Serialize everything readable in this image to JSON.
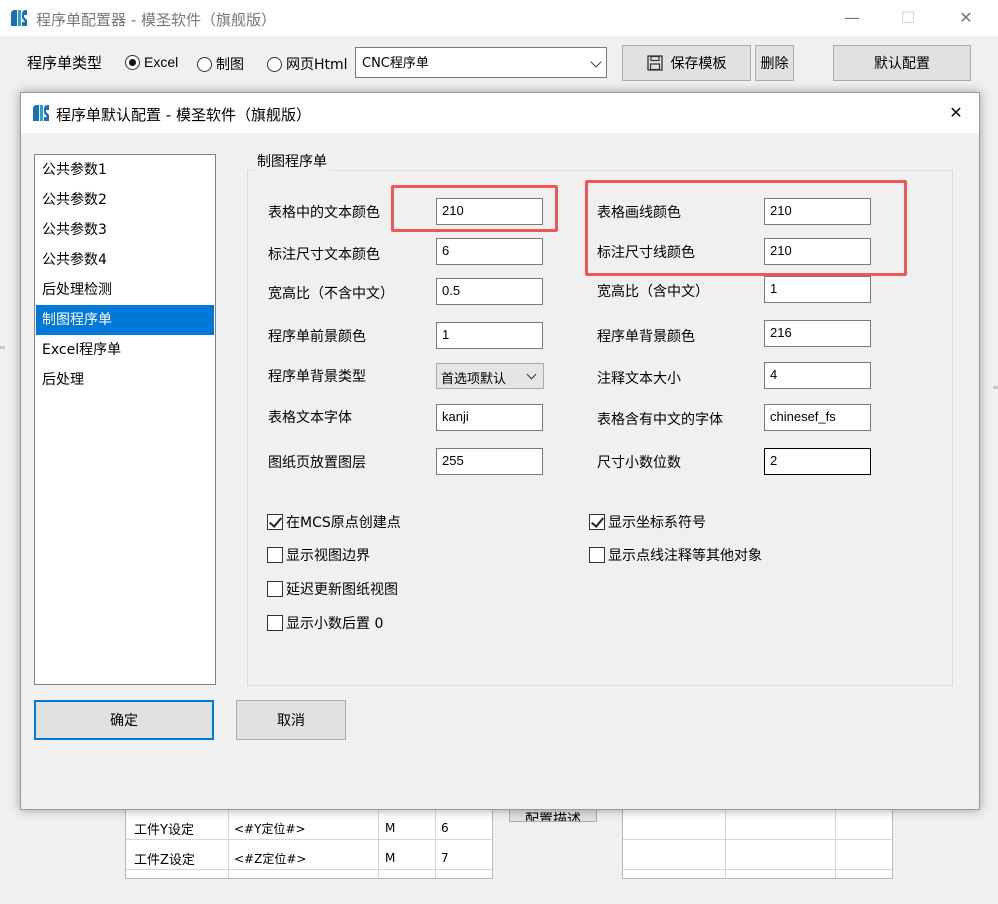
{
  "main_window": {
    "title": "程序单配置器 - 模圣软件（旗舰版）",
    "logo_text": "MS",
    "controls": {
      "minimize": "—",
      "maximize": "☐",
      "close": "✕"
    },
    "toolbar": {
      "type_label": "程序单类型",
      "radios": [
        {
          "label": "Excel",
          "selected": true
        },
        {
          "label": "制图",
          "selected": false
        },
        {
          "label": "网页Html",
          "selected": false
        }
      ],
      "template_select": "CNC程序单",
      "save_template_label": "保存模板",
      "delete_label": "删除",
      "default_config_label": "默认配置"
    },
    "background": {
      "table_rows": [
        {
          "name": "工件Y设定",
          "code": "<#Y定位#>",
          "type": "M",
          "num": "6"
        },
        {
          "name": "工件Z设定",
          "code": "<#Z定位#>",
          "type": "M",
          "num": "7"
        }
      ],
      "partial_button": "配置描述"
    }
  },
  "dialog": {
    "title": "程序单默认配置 - 模圣软件（旗舰版）",
    "close": "✕",
    "nav": [
      {
        "label": "公共参数1",
        "selected": false
      },
      {
        "label": "公共参数2",
        "selected": false
      },
      {
        "label": "公共参数3",
        "selected": false
      },
      {
        "label": "公共参数4",
        "selected": false
      },
      {
        "label": "后处理检测",
        "selected": false
      },
      {
        "label": "制图程序单",
        "selected": true
      },
      {
        "label": "Excel程序单",
        "selected": false
      },
      {
        "label": "后处理",
        "selected": false
      }
    ],
    "group_title": "制图程序单",
    "left_fields": [
      {
        "label": "表格中的文本颜色",
        "value": "210"
      },
      {
        "label": "标注尺寸文本颜色",
        "value": "6"
      },
      {
        "label": "宽高比（不含中文）",
        "value": "0.5"
      },
      {
        "label": "程序单前景颜色",
        "value": "1"
      },
      {
        "label": "程序单背景类型",
        "value": "首选项默认"
      },
      {
        "label": "表格文本字体",
        "value": "kanji"
      },
      {
        "label": "图纸页放置图层",
        "value": "255"
      }
    ],
    "right_fields": [
      {
        "label": "表格画线颜色",
        "value": "210"
      },
      {
        "label": "标注尺寸线颜色",
        "value": "210"
      },
      {
        "label": "宽高比（含中文）",
        "value": "1"
      },
      {
        "label": "程序单背景颜色",
        "value": "216"
      },
      {
        "label": "注释文本大小",
        "value": "4"
      },
      {
        "label": "表格含有中文的字体",
        "value": "chinesef_fs"
      },
      {
        "label": "尺寸小数位数",
        "value": "2"
      }
    ],
    "checkboxes_left": [
      {
        "label": "在MCS原点创建点",
        "checked": true
      },
      {
        "label": "显示视图边界",
        "checked": false
      },
      {
        "label": "延迟更新图纸视图",
        "checked": false
      },
      {
        "label": "显示小数后置 0",
        "checked": false
      }
    ],
    "checkboxes_right": [
      {
        "label": "显示坐标系符号",
        "checked": true
      },
      {
        "label": "显示点线注释等其他对象",
        "checked": false
      }
    ],
    "ok_label": "确定",
    "cancel_label": "取消"
  },
  "colors": {
    "selection_blue": "#0078d7",
    "highlight_red": "#ee5757",
    "logo_blue": "#1b6fb8",
    "logo_teal": "#29a3c9"
  }
}
